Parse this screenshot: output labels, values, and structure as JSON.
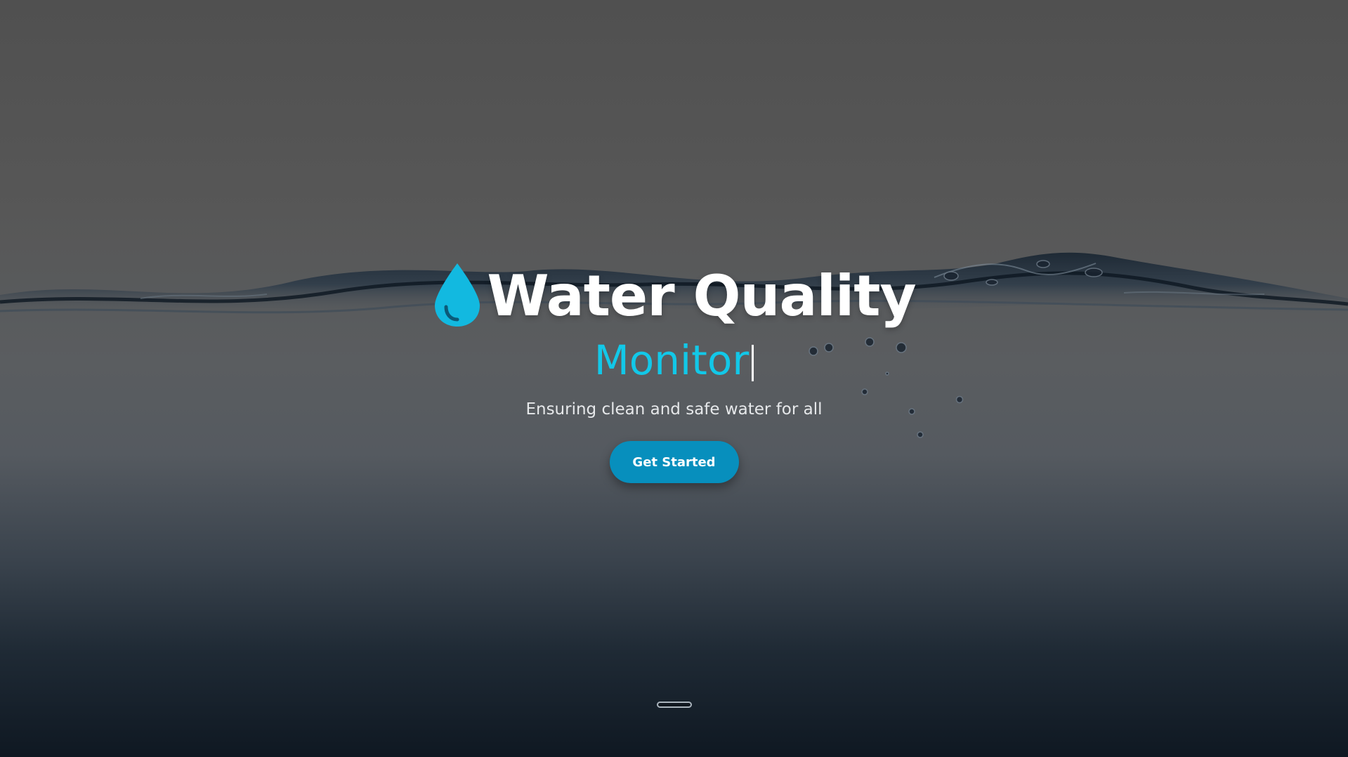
{
  "hero": {
    "title": "Water Quality",
    "subtitle": "Monitor",
    "tagline": "Ensuring clean and safe water for all",
    "cta_label": "Get Started",
    "icon": "water-drop-icon"
  },
  "colors": {
    "accent": "#12c8e8",
    "button": "#078fbd",
    "title": "#ffffff",
    "tagline": "#e6e8ea"
  }
}
